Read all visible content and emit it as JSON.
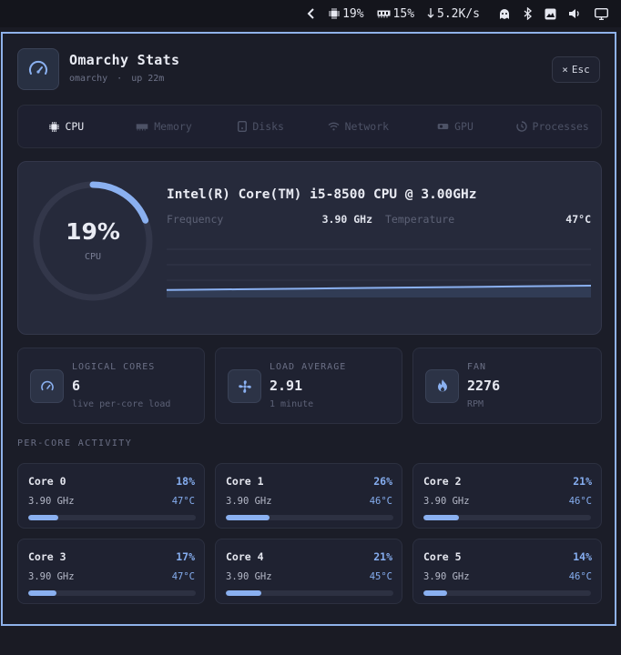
{
  "topbar": {
    "cpu": "19%",
    "mem": "15%",
    "net": "5.2K/s"
  },
  "app": {
    "title": "Omarchy Stats",
    "host": "omarchy",
    "sep": "·",
    "uptime": "up 22m",
    "esc_label": "Esc"
  },
  "tabs": [
    {
      "label": "CPU",
      "icon": "chip-icon",
      "active": true
    },
    {
      "label": "Memory",
      "icon": "memory-icon"
    },
    {
      "label": "Disks",
      "icon": "disk-icon"
    },
    {
      "label": "Network",
      "icon": "wifi-icon"
    },
    {
      "label": "GPU",
      "icon": "gpu-icon"
    },
    {
      "label": "Processes",
      "icon": "processes-icon"
    }
  ],
  "cpu": {
    "usage_pct": 19,
    "usage_label": "19%",
    "gauge_label": "CPU",
    "model": "Intel(R) Core(TM) i5-8500 CPU @ 3.00GHz",
    "freq_label": "Frequency",
    "freq_value": "3.90 GHz",
    "temp_label": "Temperature",
    "temp_value": "47°C",
    "history": [
      14,
      14.5,
      15,
      15.5,
      16,
      16.5,
      17,
      17.5,
      18,
      18.5,
      19,
      19.5,
      20
    ]
  },
  "info": [
    {
      "label": "LOGICAL CORES",
      "value": "6",
      "sub": "live per-core load",
      "icon": "speedometer-icon"
    },
    {
      "label": "LOAD AVERAGE",
      "value": "2.91",
      "sub": "1 minute",
      "icon": "fan-icon"
    },
    {
      "label": "FAN",
      "value": "2276",
      "sub": "RPM",
      "icon": "flame-icon"
    }
  ],
  "per_core_title": "PER-CORE ACTIVITY",
  "cores": [
    {
      "name": "Core 0",
      "pct": "18%",
      "load": 0.18,
      "freq": "3.90 GHz",
      "temp": "47°C"
    },
    {
      "name": "Core 1",
      "pct": "26%",
      "load": 0.26,
      "freq": "3.90 GHz",
      "temp": "46°C"
    },
    {
      "name": "Core 2",
      "pct": "21%",
      "load": 0.21,
      "freq": "3.90 GHz",
      "temp": "46°C"
    },
    {
      "name": "Core 3",
      "pct": "17%",
      "load": 0.17,
      "freq": "3.90 GHz",
      "temp": "47°C"
    },
    {
      "name": "Core 4",
      "pct": "21%",
      "load": 0.21,
      "freq": "3.90 GHz",
      "temp": "45°C"
    },
    {
      "name": "Core 5",
      "pct": "14%",
      "load": 0.14,
      "freq": "3.90 GHz",
      "temp": "46°C"
    }
  ],
  "colors": {
    "accent": "#8ab0f0",
    "border": "#8fb2ea"
  }
}
